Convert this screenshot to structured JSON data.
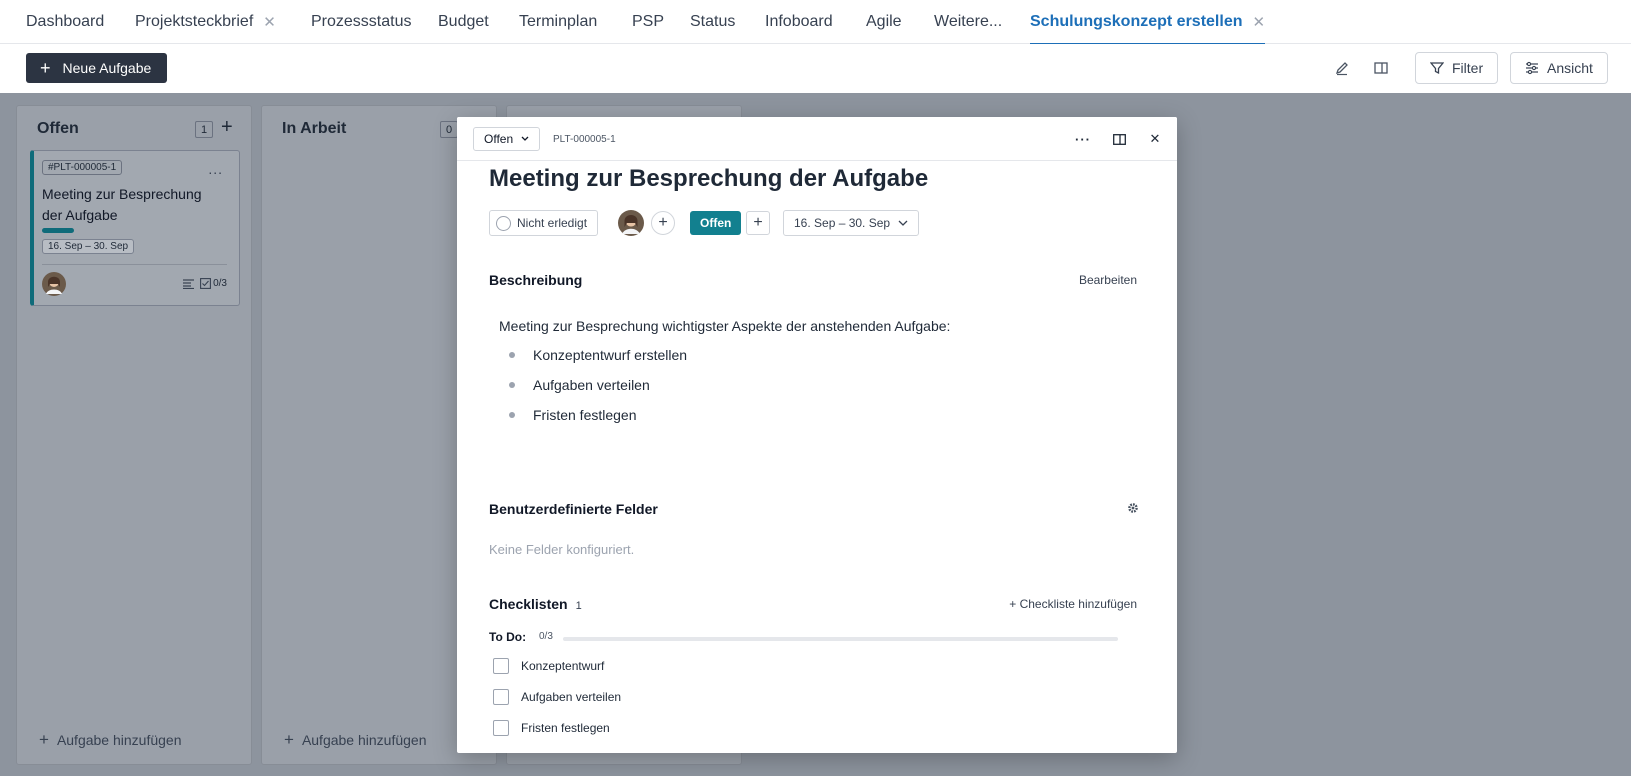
{
  "tabs": [
    {
      "label": "Dashboard",
      "closable": false,
      "active": false
    },
    {
      "label": "Projektsteckbrief",
      "closable": true,
      "active": false
    },
    {
      "label": "Prozessstatus",
      "closable": false,
      "active": false
    },
    {
      "label": "Budget",
      "closable": false,
      "active": false
    },
    {
      "label": "Terminplan",
      "closable": false,
      "active": false
    },
    {
      "label": "PSP",
      "closable": false,
      "active": false
    },
    {
      "label": "Status",
      "closable": false,
      "active": false
    },
    {
      "label": "Infoboard",
      "closable": false,
      "active": false
    },
    {
      "label": "Agile",
      "closable": false,
      "active": false
    },
    {
      "label": "Weitere...",
      "closable": false,
      "active": false
    },
    {
      "label": "Schulungskonzept erstellen",
      "closable": true,
      "active": true
    }
  ],
  "toolbar": {
    "new_task_label": "Neue Aufgabe",
    "filter_label": "Filter",
    "view_label": "Ansicht"
  },
  "board": {
    "columns": [
      {
        "title": "Offen",
        "count": "1",
        "add_task_label": "Aufgabe hinzufügen"
      },
      {
        "title": "In Arbeit",
        "count": "0",
        "add_task_label": "Aufgabe hinzufügen"
      },
      {
        "title": "",
        "count": "",
        "add_task_label": ""
      }
    ],
    "card": {
      "id": "#PLT-000005-1",
      "title": "Meeting zur Besprechung der Aufgabe",
      "date": "16. Sep – 30. Sep",
      "checklist": "0/3",
      "more": "..."
    }
  },
  "modal": {
    "status": "Offen",
    "id": "PLT-000005-1",
    "title": "Meeting zur Besprechung der Aufgabe",
    "done_label": "Nicht erledigt",
    "status_pill": "Offen",
    "date_range": "16. Sep – 30. Sep",
    "description": {
      "heading": "Beschreibung",
      "edit_label": "Bearbeiten",
      "intro": "Meeting zur Besprechung wichtigster Aspekte der anstehenden Aufgabe:",
      "bullets": [
        "Konzeptentwurf erstellen",
        "Aufgaben verteilen",
        "Fristen festlegen"
      ]
    },
    "custom_fields": {
      "heading": "Benutzerdefinierte Felder",
      "empty_text": "Keine Felder konfiguriert."
    },
    "checklists": {
      "heading": "Checklisten",
      "count": "1",
      "add_label": "Checkliste hinzufügen",
      "list_name": "To Do:",
      "progress_text": "0/3",
      "progress_fraction": 0,
      "items": [
        "Konzeptentwurf",
        "Aufgaben verteilen",
        "Fristen festlegen"
      ]
    }
  },
  "colors": {
    "accent": "#1d6fb8",
    "status_teal": "#12808f",
    "primary_button": "#2c3442"
  }
}
